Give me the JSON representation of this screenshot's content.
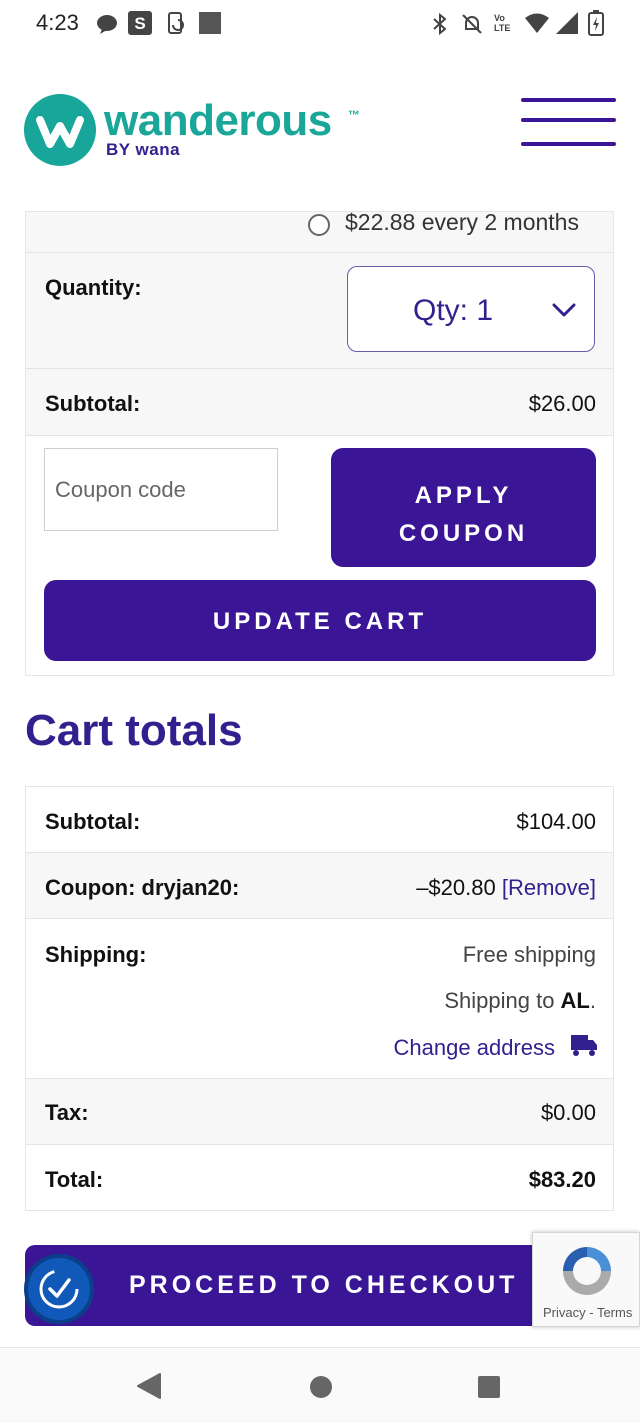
{
  "status_bar": {
    "time": "4:23",
    "left_icons": [
      "chat-bubble-icon",
      "s-app-icon",
      "screen-rotate-icon",
      "square-icon"
    ],
    "right_icons": [
      "bluetooth-icon",
      "mute-bell-icon",
      "volte-icon",
      "wifi-icon",
      "signal-icon",
      "battery-icon"
    ],
    "volte_text": "Vo LTE"
  },
  "header": {
    "brand_name": "wanderous",
    "brand_tm": "™",
    "brand_sub": "BY wana",
    "brand_color": "#1aa698",
    "menu_icon": "hamburger-menu-icon"
  },
  "product": {
    "subscription_option": "$22.88 every 2 months",
    "quantity_label": "Quantity:",
    "quantity_value": "Qty: 1",
    "subtotal_label": "Subtotal:",
    "subtotal_value": "$26.00",
    "coupon_placeholder": "Coupon code",
    "apply_coupon_line1": "APPLY",
    "apply_coupon_line2": "COUPON",
    "update_cart": "UPDATE CART"
  },
  "cart_totals": {
    "title": "Cart totals",
    "subtotal_label": "Subtotal:",
    "subtotal_value": "$104.00",
    "coupon_label": "Coupon: dryjan20:",
    "coupon_value": "–$20.80",
    "coupon_remove": "[Remove]",
    "shipping_label": "Shipping:",
    "shipping_method": "Free shipping",
    "shipping_to_prefix": "Shipping to ",
    "shipping_to_state": "AL",
    "shipping_to_suffix": ".",
    "change_address": "Change address",
    "tax_label": "Tax:",
    "tax_value": "$0.00",
    "total_label": "Total:",
    "total_value": "$83.20"
  },
  "checkout": {
    "label": "PROCEED TO CHECKOUT"
  },
  "recaptcha": {
    "privacy": "Privacy",
    "separator": " - ",
    "terms": "Terms"
  },
  "colors": {
    "accent": "#3a1596",
    "heading": "#33208f",
    "brand": "#1aa698"
  }
}
